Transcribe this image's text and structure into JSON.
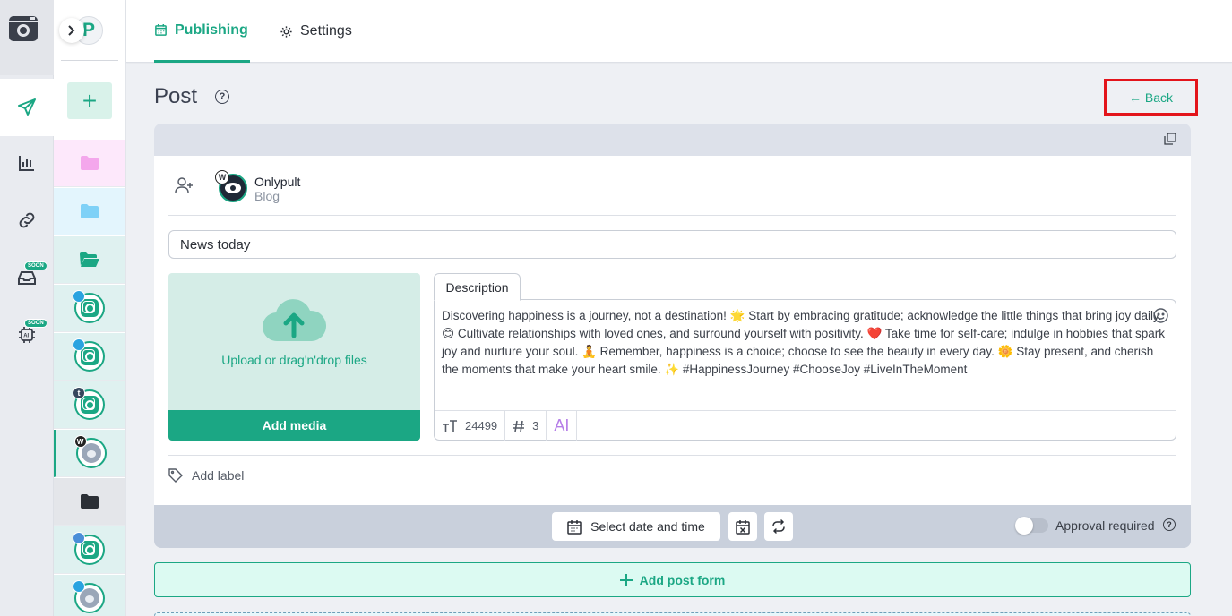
{
  "tabs": {
    "publishing": "Publishing",
    "settings": "Settings"
  },
  "account_avatar_letter": "P",
  "badges": {
    "soon_1": "SOON",
    "soon_2": "SOON",
    "ai": "AI",
    "tumblr": "t",
    "wordpress": "W"
  },
  "page": {
    "title": "Post",
    "help": "?",
    "back": "← Back"
  },
  "post": {
    "account_name": "Onlypult",
    "account_type": "Blog",
    "title_value": "News today",
    "upload_text": "Upload or drag'n'drop files",
    "add_media": "Add media",
    "description_tab": "Description",
    "description": "Discovering happiness is a journey, not a destination! 🌟 Start by embracing gratitude; acknowledge the little things that bring joy daily. 😊 Cultivate relationships with loved ones, and surround yourself with positivity. ❤️ Take time for self-care; indulge in hobbies that spark joy and nurture your soul. 🧘 Remember, happiness is a choice; choose to see the beauty in every day. 🌼 Stay present, and cherish the moments that make your heart smile. ✨ #HappinessJourney #ChooseJoy #LiveInTheMoment",
    "char_count": "24499",
    "hashtag_count": "3",
    "ai_label": "AI",
    "add_label": "Add label"
  },
  "footer": {
    "select_date": "Select date and time",
    "approval": "Approval required",
    "approval_help": "?"
  },
  "add_post_form": "Add post form",
  "colors": {
    "accent": "#1ba784",
    "back_highlight": "#e3141b"
  }
}
